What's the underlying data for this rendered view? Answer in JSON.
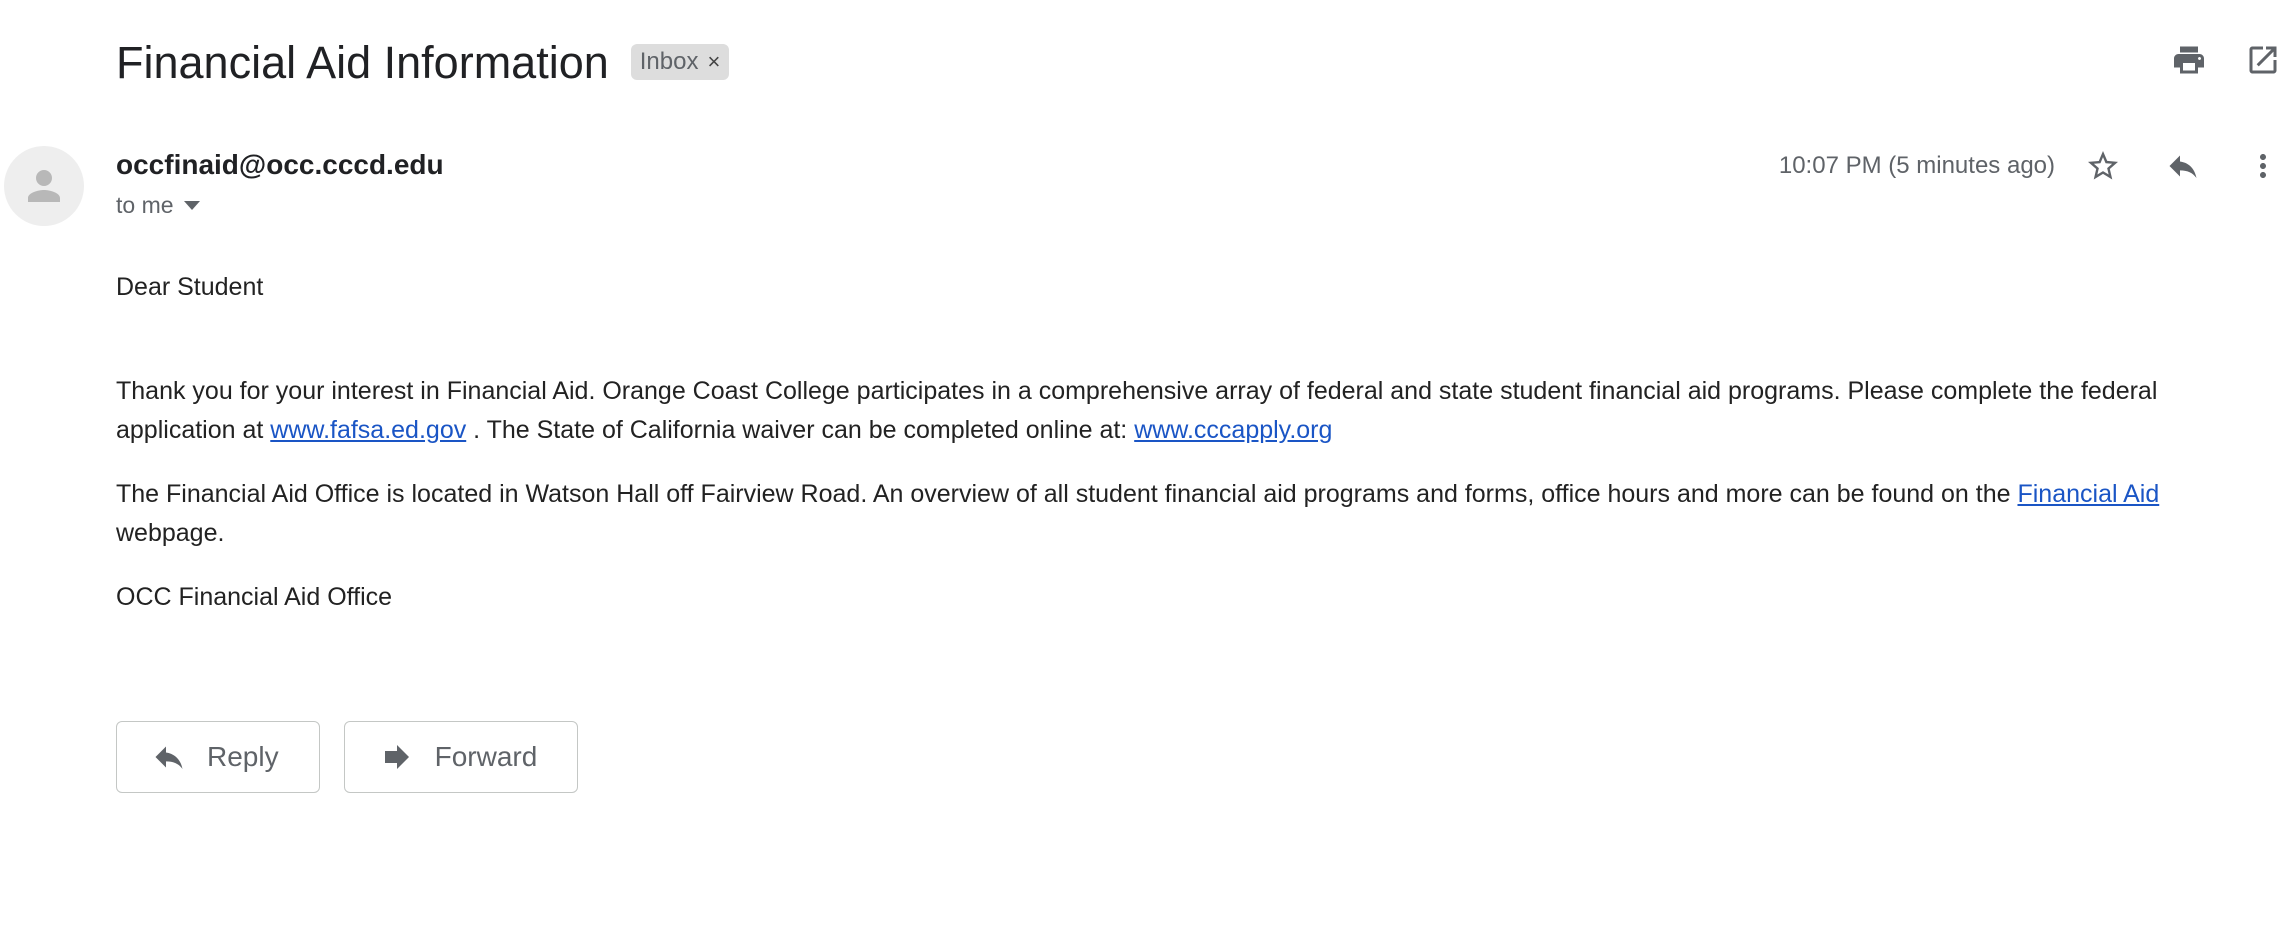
{
  "email": {
    "subject": "Financial Aid Information",
    "label": "Inbox",
    "label_remove": "×",
    "sender": "occfinaid@occ.cccd.edu",
    "recipient": "to me",
    "timestamp": "10:07 PM (5 minutes ago)"
  },
  "body": {
    "greeting": "Dear Student",
    "p1_part1": "Thank you for your interest in Financial Aid.  Orange Coast College participates in a comprehensive array of federal and state student financial aid programs.  Please complete the federal application at ",
    "p1_link1": "www.fafsa.ed.gov",
    "p1_part2": " .  The State of California waiver can be completed online at:  ",
    "p1_link2": "www.cccapply.org",
    "p2_part1": "The Financial Aid Office is located in Watson Hall off Fairview Road. An overview of all student financial aid programs and forms, office hours and more can be found on the ",
    "p2_link": "Financial Aid",
    "p2_part2": " webpage.",
    "signature": "OCC Financial Aid Office"
  },
  "actions": {
    "reply_label": "Reply",
    "forward_label": "Forward"
  },
  "icons": {
    "print": "print-icon",
    "open_new": "open-in-new-window-icon",
    "star": "star-icon",
    "reply": "reply-icon",
    "more": "more-vert-icon",
    "forward": "forward-icon",
    "avatar": "person-icon"
  },
  "colors": {
    "link": "#1a55c5",
    "chip": "#dddddd",
    "icon": "#5f6368"
  }
}
